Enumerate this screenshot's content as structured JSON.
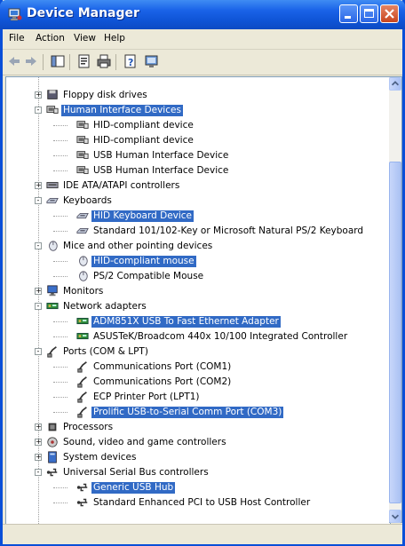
{
  "window": {
    "title": "Device Manager"
  },
  "menu": {
    "file": "File",
    "action": "Action",
    "view": "View",
    "help": "Help"
  },
  "toolbar": {
    "icons": [
      "back-arrow-icon",
      "forward-arrow-icon",
      "show-hide-console-tree-icon",
      "properties-icon",
      "print-icon",
      "help-icon",
      "scan-hardware-icon"
    ]
  },
  "tree": {
    "floppy": "Floppy disk drives",
    "hid": "Human Interface Devices",
    "hid_items": [
      "HID-compliant device",
      "HID-compliant device",
      "USB Human Interface Device",
      "USB Human Interface Device"
    ],
    "ide": "IDE ATA/ATAPI controllers",
    "keyboards": "Keyboards",
    "kb_items": [
      "HID Keyboard Device",
      "Standard 101/102-Key or Microsoft Natural PS/2 Keyboard"
    ],
    "mice": "Mice and other pointing devices",
    "mice_items": [
      "HID-compliant mouse",
      "PS/2 Compatible Mouse"
    ],
    "monitors": "Monitors",
    "network": "Network adapters",
    "net_items": [
      "ADM851X USB To Fast Ethernet Adapter",
      "ASUSTeK/Broadcom 440x 10/100 Integrated Controller"
    ],
    "ports": "Ports (COM & LPT)",
    "port_items": [
      "Communications Port (COM1)",
      "Communications Port (COM2)",
      "ECP Printer Port (LPT1)",
      "Prolific USB-to-Serial Comm Port (COM3)"
    ],
    "processors": "Processors",
    "sound": "Sound, video and game controllers",
    "system": "System devices",
    "usb": "Universal Serial Bus controllers",
    "usb_items": [
      "Generic USB Hub",
      "Standard Enhanced PCI to USB Host Controller"
    ]
  },
  "colors": {
    "title_bar": "#0f54d6",
    "selection": "#316ac5",
    "chrome": "#ece9d8"
  }
}
